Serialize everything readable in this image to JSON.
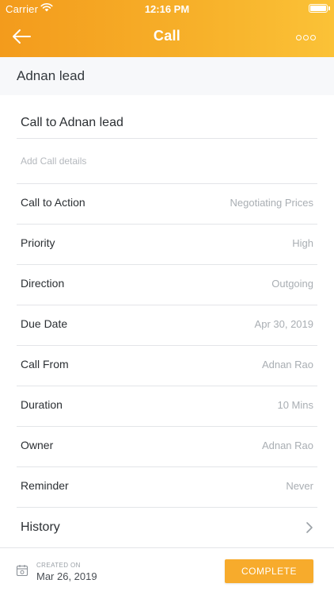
{
  "status_bar": {
    "carrier": "Carrier",
    "time": "12:16 PM"
  },
  "nav": {
    "title": "Call",
    "back_icon": "arrow-left-icon",
    "more_icon": "more-options-icon"
  },
  "record": {
    "name": "Adnan lead"
  },
  "call": {
    "subject": "Call to Adnan lead",
    "details_placeholder": "Add Call details"
  },
  "fields": [
    {
      "label": "Call to Action",
      "value": "Negotiating Prices"
    },
    {
      "label": "Priority",
      "value": "High"
    },
    {
      "label": "Direction",
      "value": "Outgoing"
    },
    {
      "label": "Due Date",
      "value": "Apr 30, 2019"
    },
    {
      "label": "Call From",
      "value": "Adnan Rao"
    },
    {
      "label": "Duration",
      "value": "10 Mins"
    },
    {
      "label": "Owner",
      "value": "Adnan Rao"
    },
    {
      "label": "Reminder",
      "value": "Never"
    }
  ],
  "history": {
    "label": "History"
  },
  "footer": {
    "created_label": "CREATED ON",
    "created_date": "Mar 26, 2019",
    "complete_label": "COMPLETE"
  },
  "colors": {
    "accent": "#f7ab2c",
    "header_start": "#f39b1c",
    "header_end": "#fbc237",
    "muted_text": "#a9aeb3",
    "divider": "#e3e5e8"
  }
}
